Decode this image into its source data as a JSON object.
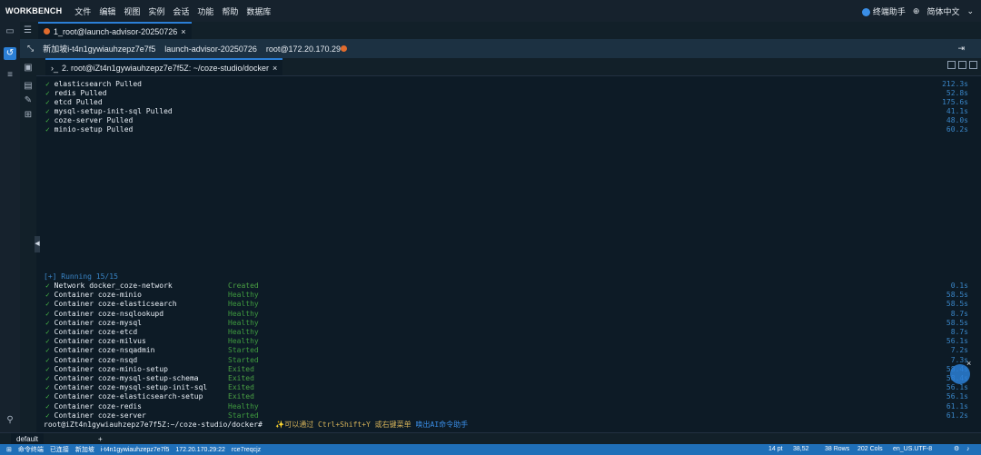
{
  "app": {
    "brand": "WORKBENCH",
    "menu": [
      "文件",
      "编辑",
      "视图",
      "实例",
      "会话",
      "功能",
      "帮助",
      "数据库"
    ],
    "right": {
      "assistant": "终端助手",
      "language": "简体中文"
    }
  },
  "tab1": {
    "label": "1_root@launch-advisor-20250726"
  },
  "session": {
    "region": "新加坡i-t4n1gywiauhzepz7e7f5",
    "instance": "launch-advisor-20250726",
    "user_host": "root@172.20.170.29"
  },
  "tab2": {
    "label": "2. root@iZt4n1gywiauhzepz7e7f5Z: ~/coze-studio/docker"
  },
  "terminal": {
    "pulled": [
      {
        "text": "elasticsearch Pulled",
        "time": "212.3s"
      },
      {
        "text": "redis Pulled",
        "time": "52.8s"
      },
      {
        "text": "etcd Pulled",
        "time": "175.6s"
      },
      {
        "text": "mysql-setup-init-sql Pulled",
        "time": "41.1s"
      },
      {
        "text": "coze-server Pulled",
        "time": "48.0s"
      },
      {
        "text": "minio-setup Pulled",
        "time": "60.2s"
      }
    ],
    "running": "[+] Running 15/15",
    "containers": [
      {
        "name": "Network docker_coze-network",
        "status": "Created",
        "time": "0.1s"
      },
      {
        "name": "Container coze-minio",
        "status": "Healthy",
        "time": "58.5s"
      },
      {
        "name": "Container coze-elasticsearch",
        "status": "Healthy",
        "time": "58.5s"
      },
      {
        "name": "Container coze-nsqlookupd",
        "status": "Healthy",
        "time": "8.7s"
      },
      {
        "name": "Container coze-mysql",
        "status": "Healthy",
        "time": "58.5s"
      },
      {
        "name": "Container coze-etcd",
        "status": "Healthy",
        "time": "8.7s"
      },
      {
        "name": "Container coze-milvus",
        "status": "Healthy",
        "time": "56.1s"
      },
      {
        "name": "Container coze-nsqadmin",
        "status": "Started",
        "time": "7.2s"
      },
      {
        "name": "Container coze-nsqd",
        "status": "Started",
        "time": "7.3s"
      },
      {
        "name": "Container coze-minio-setup",
        "status": "Exited",
        "time": "58.4s"
      },
      {
        "name": "Container coze-mysql-setup-schema",
        "status": "Exited",
        "time": "58.4s"
      },
      {
        "name": "Container coze-mysql-setup-init-sql",
        "status": "Exited",
        "time": "56.1s"
      },
      {
        "name": "Container coze-elasticsearch-setup",
        "status": "Exited",
        "time": "56.1s"
      },
      {
        "name": "Container coze-redis",
        "status": "Healthy",
        "time": "61.1s"
      },
      {
        "name": "Container coze-server",
        "status": "Started",
        "time": "61.2s"
      }
    ],
    "prompt": "root@iZt4n1gywiauhzepz7e7f5Z:~/coze-studio/docker#",
    "hint": "✨可以通过 Ctrl+Shift+Y 或右键菜单",
    "hint_link": "唤出AI命令助手"
  },
  "bottom_tab": "default",
  "statusbar": {
    "items": [
      "命令终端",
      "已连接",
      "新加坡",
      "i-t4n1gywiauhzepz7e7f5",
      "172.20.170.29:22",
      "rce7reqcjz"
    ],
    "font": "14 pt",
    "pos": "38,52",
    "rows": "38 Rows",
    "cols": "202 Cols",
    "locale": "en_US.UTF-8"
  },
  "colors": {
    "accent": "#2b7fd6",
    "check": "#46b946",
    "time": "#3a86c8"
  }
}
